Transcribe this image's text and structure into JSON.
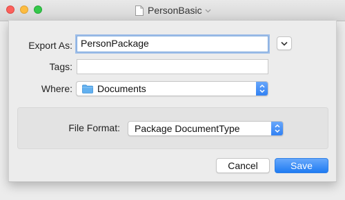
{
  "window": {
    "title": "PersonBasic"
  },
  "export_form": {
    "export_as_label": "Export As:",
    "export_as_value": "PersonPackage",
    "tags_label": "Tags:",
    "tags_value": "",
    "where_label": "Where:",
    "where_value": "Documents",
    "file_format_label": "File Format:",
    "file_format_value": "Package DocumentType"
  },
  "buttons": {
    "cancel_label": "Cancel",
    "save_label": "Save"
  },
  "colors": {
    "accent": "#2f80f3",
    "close": "#fc605c",
    "minimize": "#fdbc40",
    "zoom": "#34c84a",
    "focus_ring": "#6099e6"
  }
}
